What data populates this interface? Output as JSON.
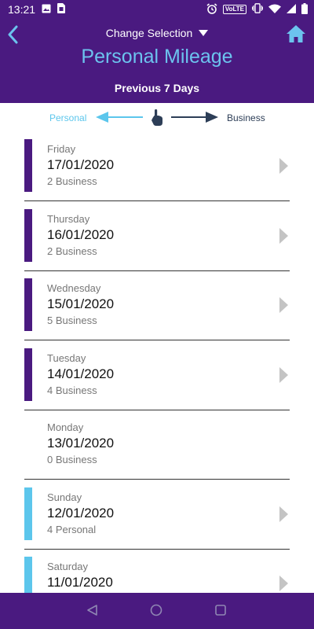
{
  "status_bar": {
    "time": "13:21",
    "volte_label": "VoLTE",
    "icons": [
      "image-icon",
      "sim-card-icon",
      "alarm-icon",
      "volte-icon",
      "vibrate-icon",
      "wifi-icon",
      "signal-icon",
      "battery-icon"
    ]
  },
  "header": {
    "change_selection_label": "Change Selection",
    "title": "Personal Mileage",
    "period": "Previous 7 Days"
  },
  "swipe_legend": {
    "personal_label": "Personal",
    "business_label": "Business"
  },
  "colors": {
    "header_bg": "#4a1a80",
    "accent_cyan": "#6cc3ee",
    "business_bar": "#4a1a80",
    "personal_bar": "#5cc6ec",
    "navy": "#2d3e57"
  },
  "days": [
    {
      "day": "Friday",
      "date": "17/01/2020",
      "count": "2 Business",
      "type": "business"
    },
    {
      "day": "Thursday",
      "date": "16/01/2020",
      "count": "2 Business",
      "type": "business"
    },
    {
      "day": "Wednesday",
      "date": "15/01/2020",
      "count": "5 Business",
      "type": "business"
    },
    {
      "day": "Tuesday",
      "date": "14/01/2020",
      "count": "4 Business",
      "type": "business"
    },
    {
      "day": "Monday",
      "date": "13/01/2020",
      "count": "0 Business",
      "type": "none"
    },
    {
      "day": "Sunday",
      "date": "12/01/2020",
      "count": "4 Personal",
      "type": "personal"
    },
    {
      "day": "Saturday",
      "date": "11/01/2020",
      "count": "",
      "type": "personal"
    }
  ]
}
